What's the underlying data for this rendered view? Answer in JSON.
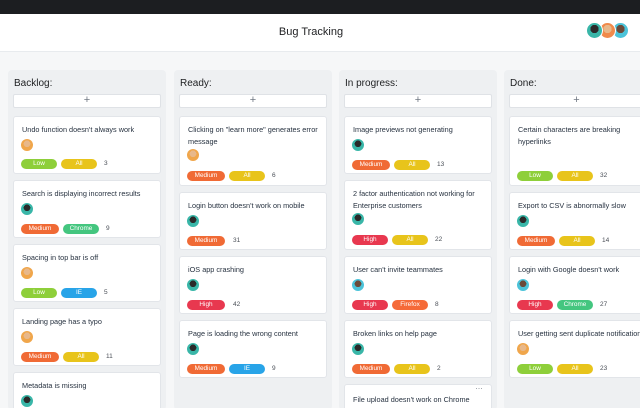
{
  "header": {
    "title": "Bug Tracking"
  },
  "colors": {
    "Low": "#8ecf3a",
    "All": "#e8c41b",
    "Medium": "#f06a35",
    "High": "#e8384f",
    "Chrome": "#44c67f",
    "IE": "#28a4e8",
    "Firefox": "#f56a38"
  },
  "icons": {
    "add": "+",
    "more": "…"
  },
  "columns": [
    {
      "title": "Backlog:",
      "cards": [
        {
          "text": "Undo function doesn't always work",
          "tags": [
            "Low",
            "All"
          ],
          "count": "3"
        },
        {
          "text": "Search is displaying incorrect results",
          "tags": [
            "Medium",
            "Chrome"
          ],
          "count": "9"
        },
        {
          "text": "Spacing in top bar is off",
          "tags": [
            "Low",
            "IE"
          ],
          "count": "5"
        },
        {
          "text": "Landing page has a typo",
          "tags": [
            "Medium",
            "All"
          ],
          "count": "11"
        },
        {
          "text": "Metadata is missing",
          "tags": [],
          "count": ""
        }
      ]
    },
    {
      "title": "Ready:",
      "cards": [
        {
          "text": "Clicking on \"learn more\" generates error message",
          "tags": [
            "Medium",
            "All"
          ],
          "count": "6"
        },
        {
          "text": "Login button doesn't work on mobile",
          "tags": [
            "Medium"
          ],
          "count": "31"
        },
        {
          "text": "iOS app crashing",
          "tags": [
            "High"
          ],
          "count": "42"
        },
        {
          "text": "Page is loading the wrong content",
          "tags": [
            "Medium",
            "IE"
          ],
          "count": "9"
        }
      ]
    },
    {
      "title": "In progress:",
      "cards": [
        {
          "text": "Image previews not generating",
          "tags": [
            "Medium",
            "All"
          ],
          "count": "13"
        },
        {
          "text": "2 factor authentication not working for Enterprise customers",
          "tags": [
            "High",
            "All"
          ],
          "count": "22"
        },
        {
          "text": "User can't invite teammates",
          "tags": [
            "High",
            "Firefox"
          ],
          "count": "8"
        },
        {
          "text": "Broken links on help page",
          "tags": [
            "Medium",
            "All"
          ],
          "count": "2"
        },
        {
          "text": "File upload doesn't work on Chrome",
          "tags": [],
          "count": ""
        }
      ]
    },
    {
      "title": "Done:",
      "cards": [
        {
          "text": "Certain characters are breaking hyperlinks",
          "tags": [
            "Low",
            "All"
          ],
          "count": "32"
        },
        {
          "text": "Export to CSV is abnormally slow",
          "tags": [
            "Medium",
            "All"
          ],
          "count": "14"
        },
        {
          "text": "Login with Google doesn't work",
          "tags": [
            "High",
            "Chrome"
          ],
          "count": "27"
        },
        {
          "text": "User getting sent duplicate notifications",
          "tags": [
            "Low",
            "All"
          ],
          "count": "23"
        }
      ]
    }
  ]
}
